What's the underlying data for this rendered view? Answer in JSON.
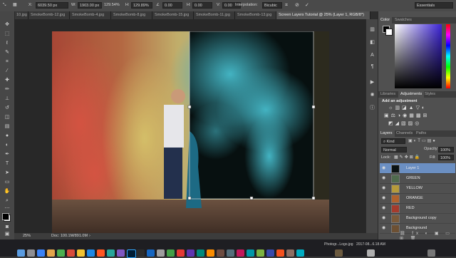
{
  "options_bar": {
    "x_label": "X:",
    "x_value": "6039.50 px",
    "w_label": "W:",
    "w_value": "1903.00 px",
    "w_percent": "129.54%",
    "h_label": "H:",
    "h_value": "129.89%",
    "h_size": "1903.00 px",
    "angle_value": "0.00",
    "h_skew_label": "H:",
    "h_skew": "0.00",
    "v_skew_label": "V:",
    "v_skew": "0.00",
    "interpolation_label": "Interpolation:",
    "interpolation_value": "Bicubic",
    "workspace": "Essentials"
  },
  "tabs": [
    "10.jpg",
    "SmokeBomb-12.jpg",
    "SmokeBomb-4.jpg",
    "SmokeBomb-8.jpg",
    "SmokeBomb-15.jpg",
    "SmokeBomb-11.jpg",
    "SmokeBomb-13.jpg",
    "Screen Layers Tutorial @ 25% (Layer 1, RGB/8*)"
  ],
  "status": {
    "zoom": "25%",
    "doc": "Doc: 100.1M/891.0M"
  },
  "color_panel": {
    "tabs": [
      "Color",
      "Swatches"
    ]
  },
  "adjustments_panel": {
    "tabs": [
      "Libraries",
      "Adjustments",
      "Styles"
    ],
    "heading": "Add an adjustment"
  },
  "layers_panel": {
    "tabs": [
      "Layers",
      "Channels",
      "Paths"
    ],
    "kind_filter": "Kind",
    "blend_mode": "Normal",
    "opacity_label": "Opacity:",
    "opacity_value": "100%",
    "lock_label": "Lock:",
    "fill_label": "Fill:",
    "fill_value": "100%",
    "layers": [
      {
        "name": "Layer 1",
        "selected": true,
        "thumb": "#0b1212"
      },
      {
        "name": "GREEN",
        "selected": false,
        "thumb": "#4f6a4d"
      },
      {
        "name": "YELLOW",
        "selected": false,
        "thumb": "#b59a3b"
      },
      {
        "name": "ORANGE",
        "selected": false,
        "thumb": "#b0622d"
      },
      {
        "name": "RED",
        "selected": false,
        "thumb": "#a53b2c"
      },
      {
        "name": "Background copy",
        "selected": false,
        "thumb": "#7a5a3a"
      },
      {
        "name": "Background",
        "selected": false,
        "thumb": "#6d5033"
      }
    ]
  },
  "dock": {
    "file_labels": [
      "Photogr...Logo.jpg",
      "2017-08...6.18 AM"
    ]
  },
  "colors": {
    "accent": "#6b8fc2",
    "foreground": "#000000",
    "background": "#ffffff"
  },
  "icons": {
    "tools": [
      "move-tool-icon",
      "marquee-tool-icon",
      "lasso-tool-icon",
      "quick-select-icon",
      "crop-tool-icon",
      "eyedropper-icon",
      "healing-brush-icon",
      "brush-tool-icon",
      "clone-stamp-icon",
      "history-brush-icon",
      "eraser-icon",
      "gradient-icon",
      "blur-icon",
      "dodge-icon",
      "pen-tool-icon",
      "type-tool-icon",
      "path-select-icon",
      "rectangle-tool-icon",
      "hand-tool-icon",
      "zoom-tool-icon"
    ]
  }
}
